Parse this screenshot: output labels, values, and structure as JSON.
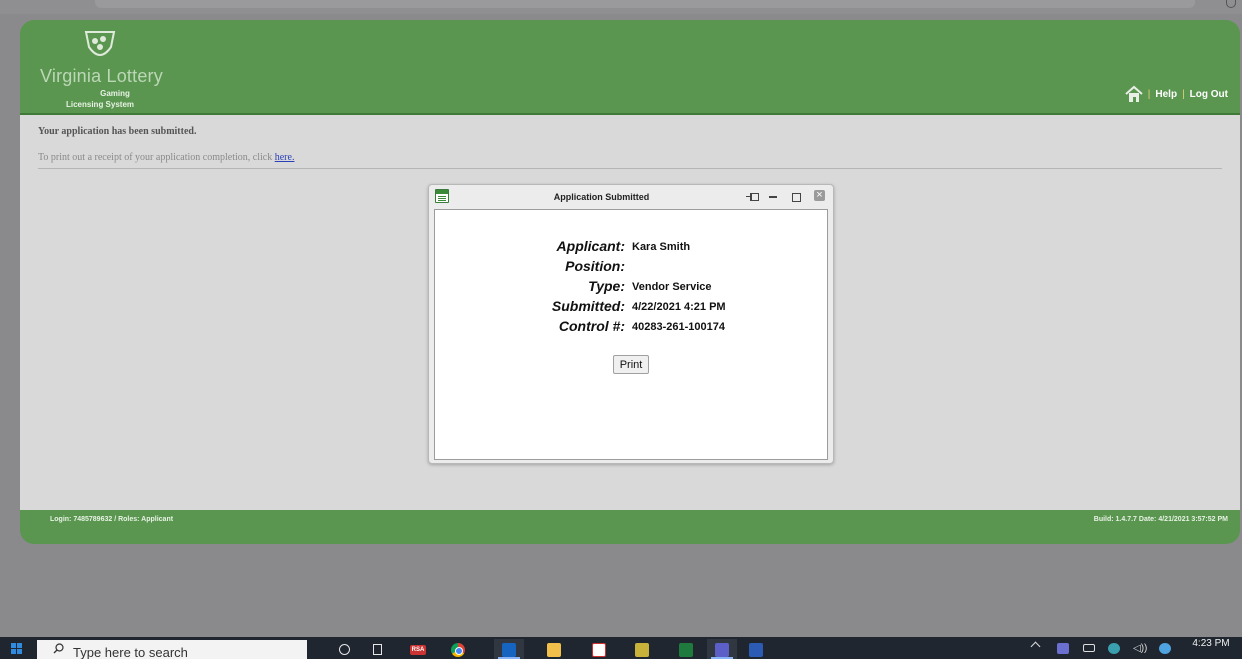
{
  "header": {
    "brand_name": "Virginia Lottery",
    "brand_sub1": "Gaming",
    "brand_sub2": "Licensing System",
    "nav": {
      "separator": "|",
      "help": "Help",
      "logout": "Log Out"
    }
  },
  "content": {
    "submitted_message": "Your application has been submitted.",
    "receipt_prefix": "To print out a receipt of your application completion, click",
    "receipt_link": "here."
  },
  "dialog": {
    "title": "Application Submitted",
    "rows": [
      {
        "label": "Applicant:",
        "value": "Kara Smith"
      },
      {
        "label": "Position:",
        "value": ""
      },
      {
        "label": "Type:",
        "value": "Vendor Service"
      },
      {
        "label": "Submitted:",
        "value": "4/22/2021 4:21 PM"
      },
      {
        "label": "Control #:",
        "value": "40283-261-100174"
      }
    ],
    "print_label": "Print"
  },
  "footer": {
    "left": "Login: 7485789632  /  Roles: Applicant",
    "right": "Build: 1.4.7.7  Date: 4/21/2021 3:57:52 PM"
  },
  "taskbar": {
    "search_placeholder": "Type here to search",
    "rsa_label": "RSA",
    "clock": "4:23 PM",
    "volume_glyph": "◁))"
  },
  "colors": {
    "header_green": "#5a9650",
    "content_bg": "#d9d9d9",
    "link_blue": "#2a40b8",
    "taskbar": "#1f2630"
  }
}
